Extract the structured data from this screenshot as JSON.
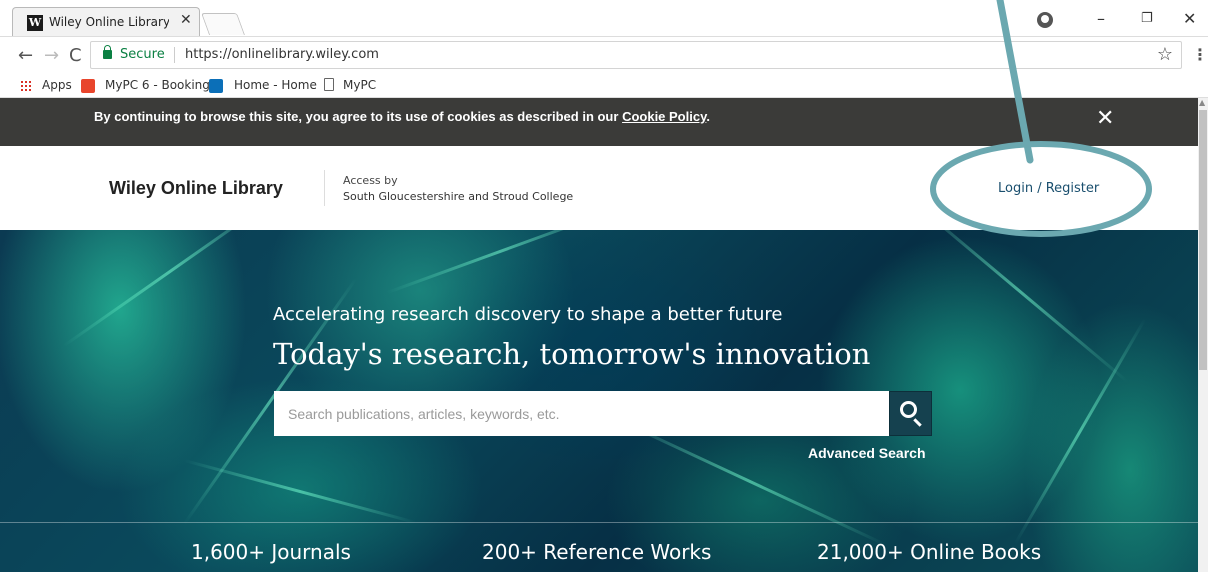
{
  "browser": {
    "tab_title": "Wiley Online Library | Scie",
    "tab_favicon": "W",
    "tab_close": "✕",
    "url": "https://onlinelibrary.wiley.com",
    "secure_label": "Secure",
    "window_controls": {
      "minimize": "–",
      "restore": "❐",
      "close": "✕"
    }
  },
  "bookmarks": [
    {
      "label": "Apps",
      "icon": "apps-grid-icon"
    },
    {
      "label": "MyPC 6 - Booking",
      "icon": "mypc-icon"
    },
    {
      "label": "Home - Home",
      "icon": "sharepoint-icon"
    },
    {
      "label": "MyPC",
      "icon": "document-icon"
    }
  ],
  "cookie_banner": {
    "text": "By continuing to browse this site, you agree to its use of cookies as described in our",
    "link": "Cookie Policy",
    "suffix": ".",
    "close": "✕"
  },
  "header": {
    "logo": "Wiley Online Library",
    "access_by": "Access by",
    "institution": "South Gloucestershire and Stroud College",
    "login": "Login / Register"
  },
  "hero": {
    "tagline": "Accelerating research discovery to shape a better future",
    "title": "Today's research, tomorrow's innovation",
    "search_placeholder": "Search publications, articles, keywords, etc.",
    "advanced_search": "Advanced Search",
    "stats": [
      "1,600+ Journals",
      "200+ Reference Works",
      "21,000+ Online Books"
    ]
  },
  "colors": {
    "cookie_banner_bg": "#3b3b39",
    "search_button_bg": "#15414f",
    "callout": "#6ba8b0",
    "link_blue": "#1a4f6e",
    "secure_green": "#0b8043"
  }
}
